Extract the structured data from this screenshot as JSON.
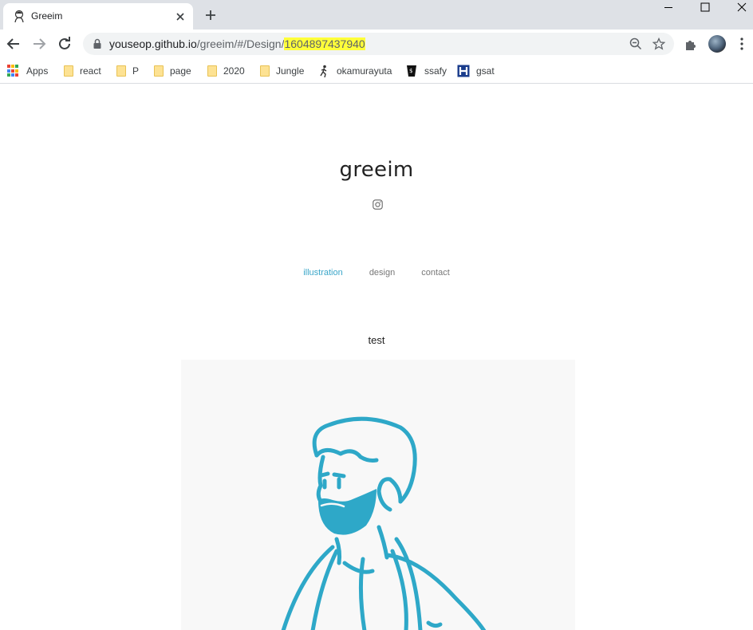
{
  "browser": {
    "tab": {
      "title": "Greeim"
    },
    "url": {
      "host": "youseop.github.io",
      "path": "/greeim/#/Design/",
      "highlight": "1604897437940"
    },
    "bookmarks": [
      {
        "label": "Apps",
        "icon": "apps-grid-icon"
      },
      {
        "label": "react",
        "icon": "folder-icon"
      },
      {
        "label": "P",
        "icon": "folder-icon"
      },
      {
        "label": "page",
        "icon": "folder-icon"
      },
      {
        "label": "2020",
        "icon": "folder-icon"
      },
      {
        "label": "Jungle",
        "icon": "folder-icon"
      },
      {
        "label": "okamurayuta",
        "icon": "runner-icon"
      },
      {
        "label": "ssafy",
        "icon": "ssafy-icon"
      },
      {
        "label": "gsat",
        "icon": "h-logo-icon"
      }
    ],
    "colors": {
      "tabstrip": "#dee1e6",
      "url_highlight": "#ffff3a"
    }
  },
  "site": {
    "title": "greeim",
    "nav": [
      {
        "label": "illustration",
        "active": true
      },
      {
        "label": "design",
        "active": false
      },
      {
        "label": "contact",
        "active": false
      }
    ],
    "post_title": "test",
    "colors": {
      "accent": "#3aa6c9",
      "illustration_line": "#2ea8c8"
    }
  }
}
